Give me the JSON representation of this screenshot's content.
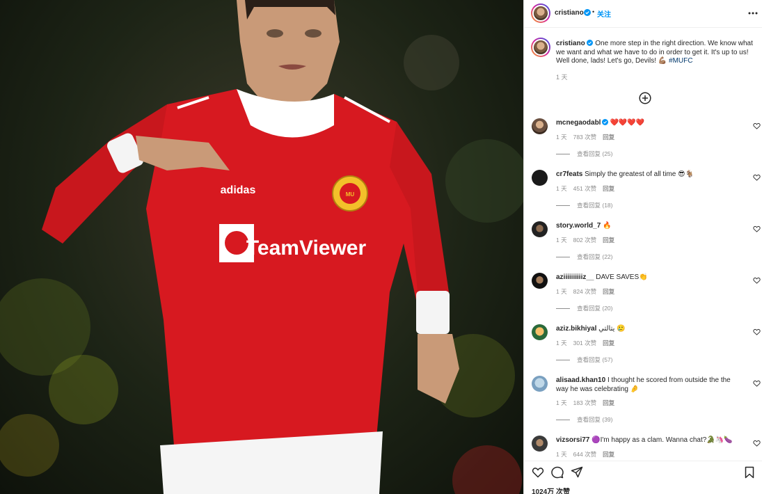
{
  "post": {
    "username": "cristiano",
    "follow_label": "关注",
    "dot": "•",
    "caption": {
      "username": "cristiano",
      "text": "One more step in the right direction. We know what we want and what we have to do in order to get it. It's up to us! Well done, lads! Let's go, Devils! 💪🏽",
      "hashtag": "#MUFC",
      "time": "1 天"
    },
    "likes": "1024万 次赞"
  },
  "photo": {
    "jersey_sponsor": "TeamViewer",
    "jersey_brand": "adidas",
    "crest_text": "MANCHESTER UNITED"
  },
  "comments": [
    {
      "user": "mcnegaodabl",
      "verified": true,
      "text": "❤️❤️❤️❤️",
      "time": "1 天",
      "likes": "783 次赞",
      "reply": "回复",
      "view_replies": "查看回复 (25)"
    },
    {
      "user": "cr7feats",
      "verified": false,
      "text": "Simply the greatest of all time 😎🐐",
      "time": "1 天",
      "likes": "451 次赞",
      "reply": "回复",
      "view_replies": "查看回复 (18)"
    },
    {
      "user": "story.world_7",
      "verified": false,
      "text": "🔥",
      "time": "1 天",
      "likes": "802 次赞",
      "reply": "回复",
      "view_replies": "查看回复 (22)"
    },
    {
      "user": "aziiiiiiiiiiz__",
      "verified": false,
      "text": "DAVE SAVES👏",
      "time": "1 天",
      "likes": "824 次赞",
      "reply": "回复",
      "view_replies": "查看回复 (20)"
    },
    {
      "user": "aziz.bikhiyal",
      "verified": false,
      "text": "يتالتي 🥲",
      "time": "1 天",
      "likes": "301 次赞",
      "reply": "回复",
      "view_replies": "查看回复 (57)"
    },
    {
      "user": "alisaad.khan10",
      "verified": false,
      "text": "I thought he scored from outside the the way he was celebrating 🤌",
      "time": "1 天",
      "likes": "183 次赞",
      "reply": "回复",
      "view_replies": "查看回复 (39)"
    },
    {
      "user": "vizsorsi77",
      "verified": false,
      "text": "🟣I'm happy as a clam. Wanna chat?🐊🦄🍆",
      "time": "1 天",
      "likes": "644 次赞",
      "reply": "回复",
      "view_replies": ""
    }
  ],
  "colors": {
    "accent": "#0095f6",
    "hashtag": "#00376b",
    "muted": "#8e8e8e",
    "jersey": "#d71920"
  }
}
